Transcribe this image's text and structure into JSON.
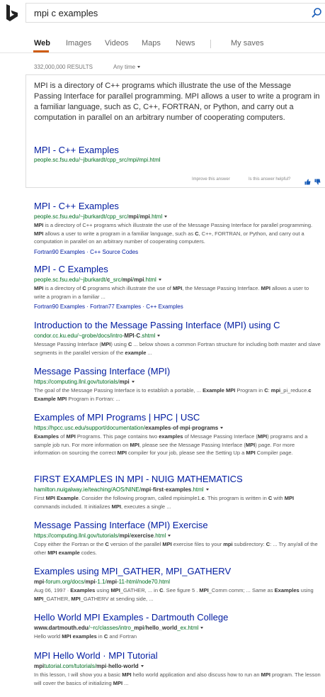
{
  "search": {
    "query": "mpi c examples"
  },
  "nav": {
    "tabs": [
      {
        "label": "Web",
        "active": true
      },
      {
        "label": "Images"
      },
      {
        "label": "Videos"
      },
      {
        "label": "Maps"
      },
      {
        "label": "News"
      },
      {
        "label": "My saves"
      }
    ]
  },
  "meta": {
    "count": "332,000,000 RESULTS",
    "time_filter": "Any time"
  },
  "answer": {
    "text": "MPI is a directory of C++ programs which illustrate the use of the Message Passing Interface for parallel programming. MPI allows a user to write a program in a familiar language, such as C, C++, FORTRAN, or Python, and carry out a computation in parallel on an arbitrary number of cooperating computers.",
    "title": "MPI - C++ Examples",
    "url": "people.sc.fsu.edu/~jburkardt/cpp_src/mpi/mpi.html",
    "improve": "Improve this answer",
    "helpful": "Is this answer helpful?"
  },
  "results": [
    {
      "title": "MPI - C++ Examples",
      "url_html": "people.sc.fsu.edu/~jburkardt/cpp_src/<b>mpi</b>/<b>mpi</b>.html",
      "snippet_html": "<b>MPI</b> is a directory of C++ programs which illustrate the use of the Message Passing Interface for parallel programming. <b>MPI</b> allows a user to write a program in a familiar language, such as <b>C</b>, C++, FORTRAN, or Python, and carry out a computation in parallel on an arbitrary number of cooperating computers.",
      "links": [
        "Fortran90 Examples",
        "C++ Source Codes"
      ]
    },
    {
      "title": "MPI - C Examples",
      "url_html": "people.sc.fsu.edu/~jburkardt/<b>c</b>_src/<b>mpi</b>/<b>mpi</b>.html",
      "snippet_html": "<b>MPI</b> is a directory of <b>C</b> programs which illustrate the use of <b>MPI</b>, the Message Passing Interface. <b>MPI</b> allows a user to write a program in a familiar ...",
      "links": [
        "Fortran90 Examples",
        "Fortran77 Examples",
        "C++ Examples"
      ]
    },
    {
      "title": "Introduction to the Message Passing Interface (MPI) using C",
      "url_html": "condor.cc.ku.edu/~grobe/docs/intro-<b>MPI</b>-<b>C</b>.shtml",
      "snippet_html": "Message Passing Interface (<b>MPI</b>) using <b>C</b> ... below shows a common Fortran structure for including both master and slave segments in the parallel version of the <b>example</b> ...",
      "links": []
    },
    {
      "title": "Message Passing Interface (MPI)",
      "url_html": "https://computing.llnl.gov/tutorials/<b>mpi</b>",
      "snippet_html": "The goal of the Message Passing Interface is to establish a portable, ... <b>Example MPI</b> Program in <b>C</b>: <b>mpi</b>_pi_reduce.<b>c Example MPI</b> Program in Fortran: ...",
      "links": []
    },
    {
      "title": "Examples of MPI Programs | HPC | USC",
      "url_html": "https://hpcc.usc.edu/support/documentation/<b>examples</b>-<b>of</b>-<b>mpi</b>-<b>programs</b>",
      "snippet_html": "<b>Examples</b> of <b>MPI</b> Programs. This page contains two <b>examples</b> of Message Passing Interface (<b>MPI</b>) programs and a sample job run. For more information on <b>MPI</b>, please see the Message Passing Interface (<b>MPI</b>) page. For more information on sourcing the correct <b>MPI</b> compiler for your job, please see the Setting Up a <b>MPI</b> Compiler page.",
      "links": []
    },
    {
      "title": "FIRST EXAMPLES IN MPI - NUIG MATHEMATICS",
      "url_html": "hamilton.nuigalway.ie/teaching/AOS/NINE/<b>mpi</b>-<b>first</b>-<b>examples</b>.html",
      "snippet_html": "First <b>MPI Example</b>. Consider the following program, called mpisimple1.<b>c</b>. This program is written in <b>C</b> with <b>MPI</b> commands included. It initializes <b>MPI</b>, executes a single ...",
      "links": []
    },
    {
      "title": "Message Passing Interface (MPI) Exercise",
      "url_html": "https://computing.llnl.gov/tutorials/<b>mpi</b>/<b>exercise</b>.html",
      "snippet_html": "Copy either the Fortran or the <b>C</b> version of the parallel <b>MPI</b> exercise files to your <b>mpi</b> subdirectory: <b>C</b>: ... Try any/all of the other <b>MPI example</b> codes.",
      "links": []
    },
    {
      "title": "Examples using MPI_GATHER, MPI_GATHERV",
      "url_html": "<b>mpi</b>-forum.org/docs/<b>mpi</b>-1.1/<b>mpi</b>-11-html/node70.html",
      "snippet_html": "Aug 06, 1997 · <b>Examples</b> using <b>MPI</b>_GATHER, ... in <b>C</b>. See figure 5 . <b>MPI</b>_Comm comm; ... Same as <b>Examples</b> using <b>MPI</b>_GATHER, <b>MPI</b>_GATHERV at sending side, ...",
      "links": []
    },
    {
      "title": "Hello World MPI Examples - Dartmouth College",
      "url_html": "<b>www.dartmouth.edu</b>/~rc/classes/intro_<b>mpi</b>/<b>hello_world</b>_ex.html",
      "snippet_html": "Hello world <b>MPI examples</b> in <b>C</b> and Fortran",
      "links": []
    },
    {
      "title": "MPI Hello World · MPI Tutorial",
      "url_html": "<b>mpi</b>tutorial.com/tutorials/<b>mpi</b>-<b>hello</b>-<b>world</b>",
      "snippet_html": "In this lesson, I will show you a basic <b>MPI</b> hello world application and also discuss how to run an <b>MPI</b> program. The lesson will cover the basics of initializing <b>MPI</b> ...",
      "links": []
    }
  ]
}
